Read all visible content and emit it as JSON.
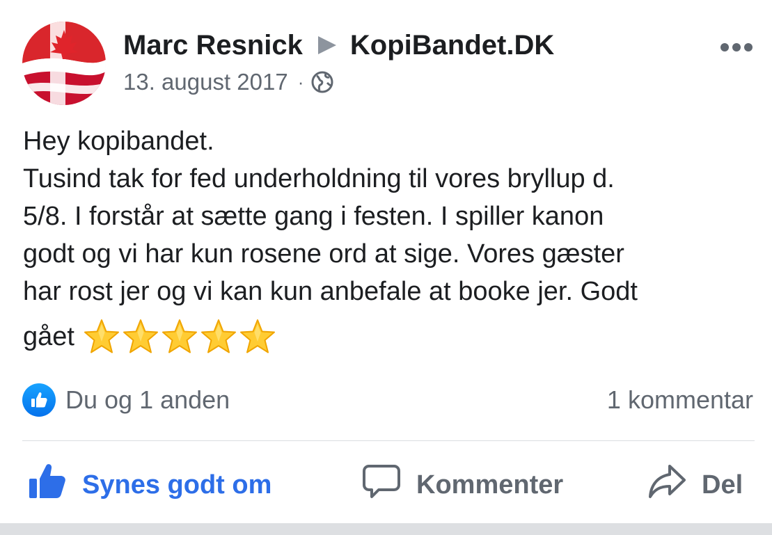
{
  "post": {
    "author": "Marc Resnick",
    "target_page": "KopiBandet.DK",
    "date": "13. august 2017",
    "separator": "·",
    "privacy_icon": "globe-icon",
    "text_lines": [
      "Hey kopibandet.",
      "Tusind tak for fed underholdning til vores bryllup d.",
      "5/8. I forstår at sætte gang i festen. I spiller kanon",
      "godt og vi har kun rosene ord at sige. Vores gæster",
      "har rost jer og vi kan kun anbefale at booke jer. Godt"
    ],
    "last_line_text": "gået",
    "star_emoji_count": 5
  },
  "reactions": {
    "likes_text": "Du og 1 anden",
    "comments_text": "1 kommentar"
  },
  "actions": {
    "like_label": "Synes godt om",
    "comment_label": "Kommenter",
    "share_label": "Del"
  },
  "colors": {
    "accent": "#2d6ee8",
    "muted": "#606770",
    "text": "#1c1e21",
    "star": "#ffcc33"
  }
}
